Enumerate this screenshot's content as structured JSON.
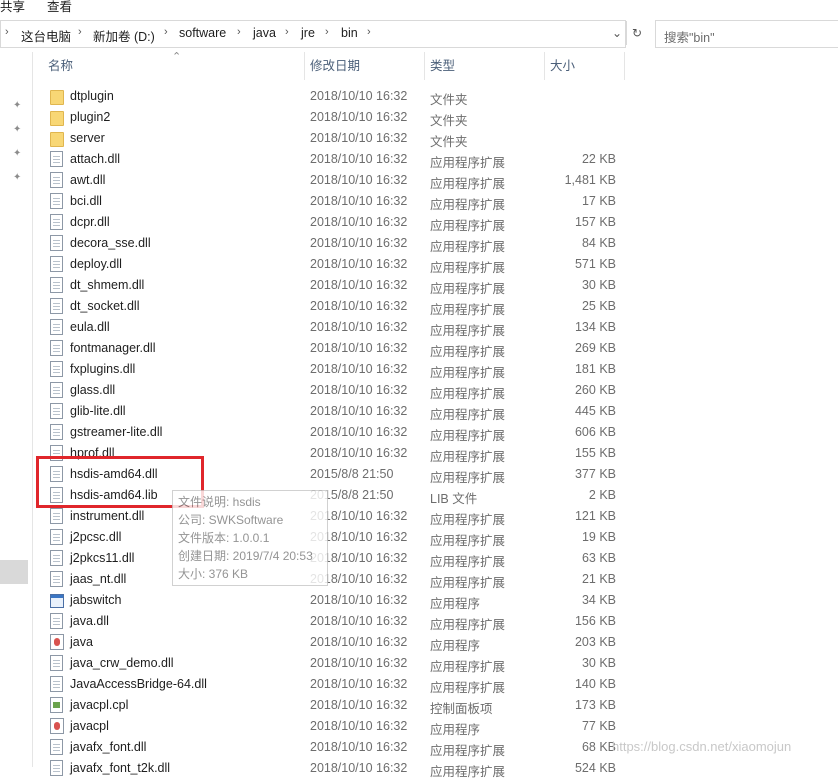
{
  "ribbon": {
    "tabs": [
      "共享",
      "查看"
    ]
  },
  "address": {
    "crumbs": [
      "这台电脑",
      "新加卷 (D:)",
      "software",
      "java",
      "jre",
      "bin"
    ],
    "dropdown_icon": "chevron-down-icon",
    "refresh_icon": "refresh-icon"
  },
  "search": {
    "placeholder": "搜索\"bin\""
  },
  "columns": {
    "name": "名称",
    "date": "修改日期",
    "type": "类型",
    "size": "大小"
  },
  "files": [
    {
      "name": "dtplugin",
      "date": "2018/10/10 16:32",
      "type": "文件夹",
      "size": "",
      "icon": "folder-icon"
    },
    {
      "name": "plugin2",
      "date": "2018/10/10 16:32",
      "type": "文件夹",
      "size": "",
      "icon": "folder-icon"
    },
    {
      "name": "server",
      "date": "2018/10/10 16:32",
      "type": "文件夹",
      "size": "",
      "icon": "folder-icon"
    },
    {
      "name": "attach.dll",
      "date": "2018/10/10 16:32",
      "type": "应用程序扩展",
      "size": "22 KB",
      "icon": "dll-file-icon"
    },
    {
      "name": "awt.dll",
      "date": "2018/10/10 16:32",
      "type": "应用程序扩展",
      "size": "1,481 KB",
      "icon": "dll-file-icon"
    },
    {
      "name": "bci.dll",
      "date": "2018/10/10 16:32",
      "type": "应用程序扩展",
      "size": "17 KB",
      "icon": "dll-file-icon"
    },
    {
      "name": "dcpr.dll",
      "date": "2018/10/10 16:32",
      "type": "应用程序扩展",
      "size": "157 KB",
      "icon": "dll-file-icon"
    },
    {
      "name": "decora_sse.dll",
      "date": "2018/10/10 16:32",
      "type": "应用程序扩展",
      "size": "84 KB",
      "icon": "dll-file-icon"
    },
    {
      "name": "deploy.dll",
      "date": "2018/10/10 16:32",
      "type": "应用程序扩展",
      "size": "571 KB",
      "icon": "dll-file-icon"
    },
    {
      "name": "dt_shmem.dll",
      "date": "2018/10/10 16:32",
      "type": "应用程序扩展",
      "size": "30 KB",
      "icon": "dll-file-icon"
    },
    {
      "name": "dt_socket.dll",
      "date": "2018/10/10 16:32",
      "type": "应用程序扩展",
      "size": "25 KB",
      "icon": "dll-file-icon"
    },
    {
      "name": "eula.dll",
      "date": "2018/10/10 16:32",
      "type": "应用程序扩展",
      "size": "134 KB",
      "icon": "dll-file-icon"
    },
    {
      "name": "fontmanager.dll",
      "date": "2018/10/10 16:32",
      "type": "应用程序扩展",
      "size": "269 KB",
      "icon": "dll-file-icon"
    },
    {
      "name": "fxplugins.dll",
      "date": "2018/10/10 16:32",
      "type": "应用程序扩展",
      "size": "181 KB",
      "icon": "dll-file-icon"
    },
    {
      "name": "glass.dll",
      "date": "2018/10/10 16:32",
      "type": "应用程序扩展",
      "size": "260 KB",
      "icon": "dll-file-icon"
    },
    {
      "name": "glib-lite.dll",
      "date": "2018/10/10 16:32",
      "type": "应用程序扩展",
      "size": "445 KB",
      "icon": "dll-file-icon"
    },
    {
      "name": "gstreamer-lite.dll",
      "date": "2018/10/10 16:32",
      "type": "应用程序扩展",
      "size": "606 KB",
      "icon": "dll-file-icon"
    },
    {
      "name": "hprof.dll",
      "date": "2018/10/10 16:32",
      "type": "应用程序扩展",
      "size": "155 KB",
      "icon": "dll-file-icon"
    },
    {
      "name": "hsdis-amd64.dll",
      "date": "2015/8/8 21:50",
      "type": "应用程序扩展",
      "size": "377 KB",
      "icon": "dll-file-icon"
    },
    {
      "name": "hsdis-amd64.lib",
      "date": "2015/8/8 21:50",
      "type": "LIB 文件",
      "size": "2 KB",
      "icon": "lib-file-icon"
    },
    {
      "name": "instrument.dll",
      "date": "2018/10/10 16:32",
      "type": "应用程序扩展",
      "size": "121 KB",
      "icon": "dll-file-icon"
    },
    {
      "name": "j2pcsc.dll",
      "date": "2018/10/10 16:32",
      "type": "应用程序扩展",
      "size": "19 KB",
      "icon": "dll-file-icon"
    },
    {
      "name": "j2pkcs11.dll",
      "date": "2018/10/10 16:32",
      "type": "应用程序扩展",
      "size": "63 KB",
      "icon": "dll-file-icon"
    },
    {
      "name": "jaas_nt.dll",
      "date": "2018/10/10 16:32",
      "type": "应用程序扩展",
      "size": "21 KB",
      "icon": "dll-file-icon"
    },
    {
      "name": "jabswitch",
      "date": "2018/10/10 16:32",
      "type": "应用程序",
      "size": "34 KB",
      "icon": "exe-file-icon"
    },
    {
      "name": "java.dll",
      "date": "2018/10/10 16:32",
      "type": "应用程序扩展",
      "size": "156 KB",
      "icon": "dll-file-icon"
    },
    {
      "name": "java",
      "date": "2018/10/10 16:32",
      "type": "应用程序",
      "size": "203 KB",
      "icon": "java-exe-icon"
    },
    {
      "name": "java_crw_demo.dll",
      "date": "2018/10/10 16:32",
      "type": "应用程序扩展",
      "size": "30 KB",
      "icon": "dll-file-icon"
    },
    {
      "name": "JavaAccessBridge-64.dll",
      "date": "2018/10/10 16:32",
      "type": "应用程序扩展",
      "size": "140 KB",
      "icon": "dll-file-icon"
    },
    {
      "name": "javacpl.cpl",
      "date": "2018/10/10 16:32",
      "type": "控制面板项",
      "size": "173 KB",
      "icon": "cpl-file-icon"
    },
    {
      "name": "javacpl",
      "date": "2018/10/10 16:32",
      "type": "应用程序",
      "size": "77 KB",
      "icon": "java-exe-icon"
    },
    {
      "name": "javafx_font.dll",
      "date": "2018/10/10 16:32",
      "type": "应用程序扩展",
      "size": "68 KB",
      "icon": "dll-file-icon"
    },
    {
      "name": "javafx_font_t2k.dll",
      "date": "2018/10/10 16:32",
      "type": "应用程序扩展",
      "size": "524 KB",
      "icon": "dll-file-icon"
    }
  ],
  "tooltip": {
    "lines": [
      "文件说明: hsdis",
      "公司: SWKSoftware",
      "文件版本: 1.0.0.1",
      "创建日期: 2019/7/4 20:53",
      "大小: 376 KB"
    ]
  },
  "watermark": "https://blog.csdn.net/xiaomojun",
  "colors": {
    "highlight_box": "#e0262b",
    "header_text": "#4c607a"
  }
}
